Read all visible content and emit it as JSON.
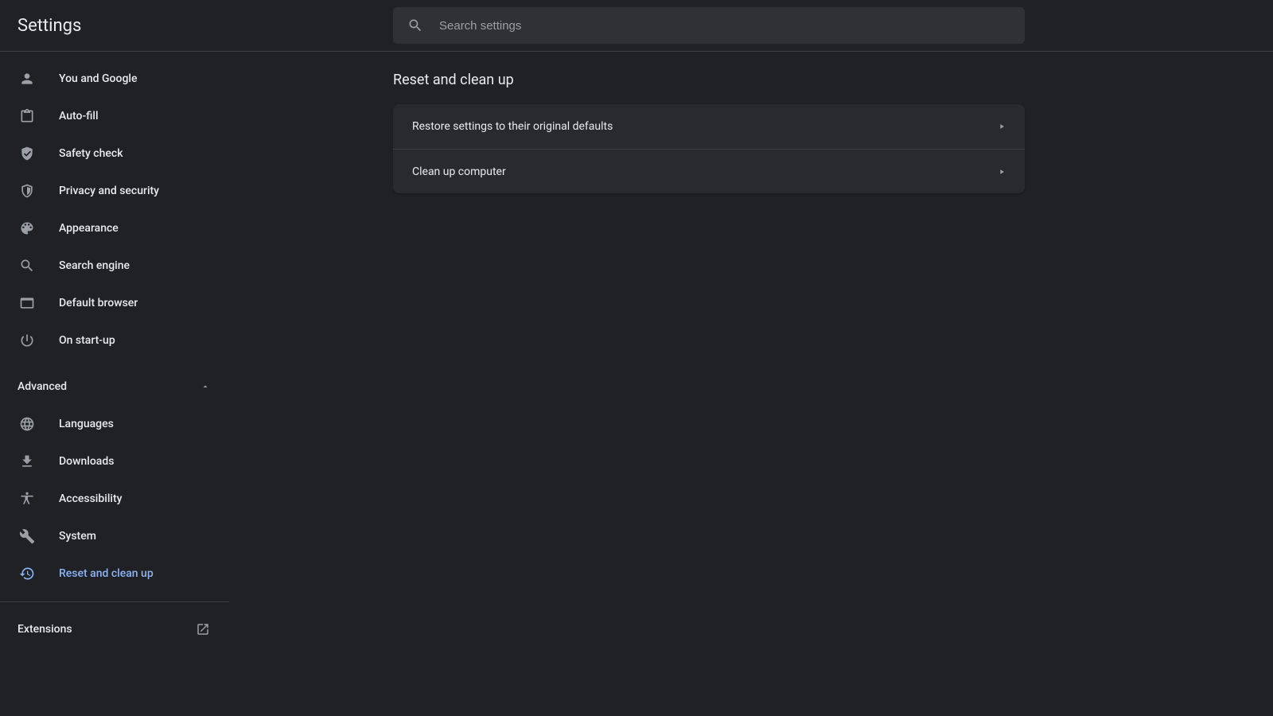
{
  "header": {
    "title": "Settings",
    "search_placeholder": "Search settings"
  },
  "sidebar": {
    "items_basic": [
      {
        "id": "you-and-google",
        "label": "You and Google",
        "icon": "person"
      },
      {
        "id": "auto-fill",
        "label": "Auto-fill",
        "icon": "clipboard"
      },
      {
        "id": "safety-check",
        "label": "Safety check",
        "icon": "shield-check"
      },
      {
        "id": "privacy-security",
        "label": "Privacy and security",
        "icon": "shield"
      },
      {
        "id": "appearance",
        "label": "Appearance",
        "icon": "palette"
      },
      {
        "id": "search-engine",
        "label": "Search engine",
        "icon": "search"
      },
      {
        "id": "default-browser",
        "label": "Default browser",
        "icon": "browser"
      },
      {
        "id": "on-startup",
        "label": "On start-up",
        "icon": "power"
      }
    ],
    "advanced_header": "Advanced",
    "items_advanced": [
      {
        "id": "languages",
        "label": "Languages",
        "icon": "globe"
      },
      {
        "id": "downloads",
        "label": "Downloads",
        "icon": "download"
      },
      {
        "id": "accessibility",
        "label": "Accessibility",
        "icon": "accessibility"
      },
      {
        "id": "system",
        "label": "System",
        "icon": "wrench"
      },
      {
        "id": "reset-cleanup",
        "label": "Reset and clean up",
        "icon": "history",
        "active": true
      }
    ],
    "extensions": "Extensions"
  },
  "main": {
    "section_title": "Reset and clean up",
    "rows": [
      {
        "id": "restore-defaults",
        "label": "Restore settings to their original defaults"
      },
      {
        "id": "clean-up",
        "label": "Clean up computer"
      }
    ]
  }
}
